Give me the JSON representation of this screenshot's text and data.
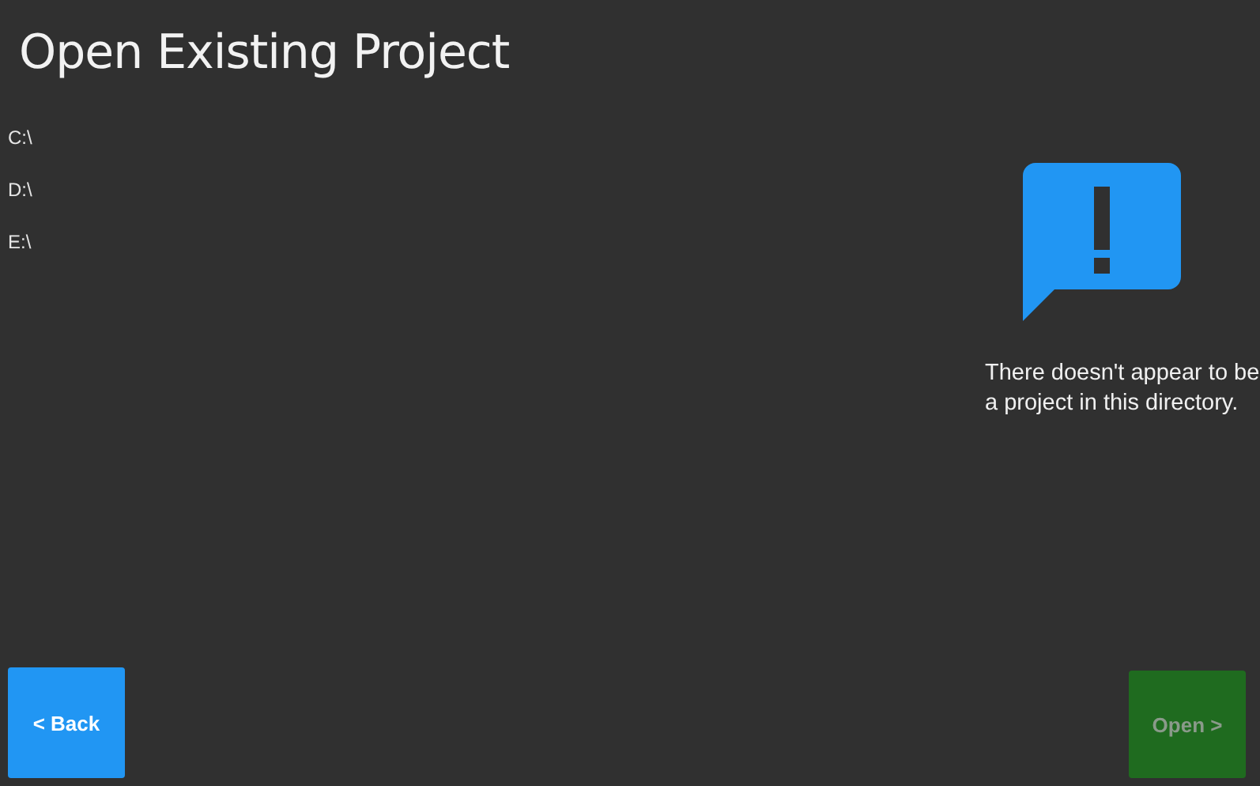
{
  "title": "Open Existing Project",
  "drives": [
    {
      "label": "C:\\"
    },
    {
      "label": "D:\\"
    },
    {
      "label": "E:\\"
    }
  ],
  "message": "There doesn't appear to be a project in this directory.",
  "buttons": [
    {
      "kind": "back",
      "label": "< Back",
      "disabled": false
    },
    {
      "kind": "open",
      "label": "Open >",
      "disabled": true
    }
  ]
}
